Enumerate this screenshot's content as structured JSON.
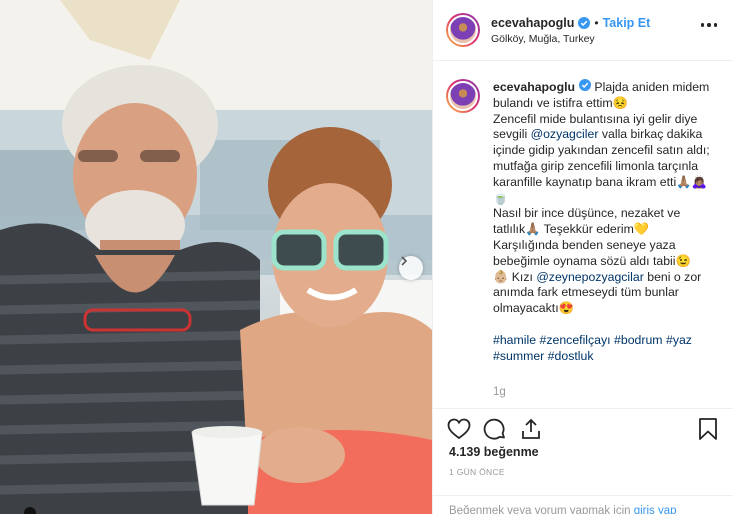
{
  "post": {
    "username": "ecevahapoglu",
    "separator": "•",
    "follow_label": "Takip Et",
    "location": "Gölköy, Muğla, Turkey",
    "caption_username": "ecevahapoglu",
    "caption_parts": [
      {
        "type": "text",
        "value": " Plajda aniden midem bulandı ve istifra ettim😣\nZencefil mide bulantısına iyi gelir diye sevgili "
      },
      {
        "type": "mention",
        "value": "@ozyagciler"
      },
      {
        "type": "text",
        "value": " valla birkaç dakika içinde gidip yakından zencefil satın aldı; mutfağa girip zencefili limonla tarçınla karanfille kaynatıp bana ikram etti🙏🏽🙇🏽‍♀️🍵\nNasıl bir ince düşünce, nezaket ve tatlılık🙏🏽 Teşekkür ederim💛\nKarşılığında benden seneye yaza bebeğimle oynama sözü aldı tabii😉\n👶🏼 Kızı "
      },
      {
        "type": "mention",
        "value": "@zeynepozyagcilar"
      },
      {
        "type": "text",
        "value": " beni o zor anımda fark etmeseydi tüm bunlar olmayacaktı😍\n\n"
      },
      {
        "type": "tag",
        "value": "#hamile"
      },
      {
        "type": "text",
        "value": " "
      },
      {
        "type": "tag",
        "value": "#zencefilçayı"
      },
      {
        "type": "text",
        "value": " "
      },
      {
        "type": "tag",
        "value": "#bodrum"
      },
      {
        "type": "text",
        "value": " "
      },
      {
        "type": "tag",
        "value": "#yaz"
      },
      {
        "type": "text",
        "value": "\n"
      },
      {
        "type": "tag",
        "value": "#summer"
      },
      {
        "type": "text",
        "value": " "
      },
      {
        "type": "tag",
        "value": "#dostluk"
      }
    ],
    "caption_age": "1g",
    "likes": "4.139 beğenme",
    "time_ago": "1 GÜN ÖNCE",
    "login_text": "Beğenmek veya yorum yapmak için ",
    "login_link": "giriş yap"
  },
  "icons": {
    "verified": "verified-badge-icon",
    "more": "more-options-icon",
    "like": "heart-icon",
    "comment": "comment-bubble-icon",
    "share": "share-arrow-icon",
    "save": "bookmark-icon",
    "carousel_next": "chevron-right-icon"
  },
  "colors": {
    "link_blue": "#3897f0",
    "tag_blue": "#003569",
    "text": "#262626",
    "muted": "#999999",
    "border": "#efefef"
  }
}
